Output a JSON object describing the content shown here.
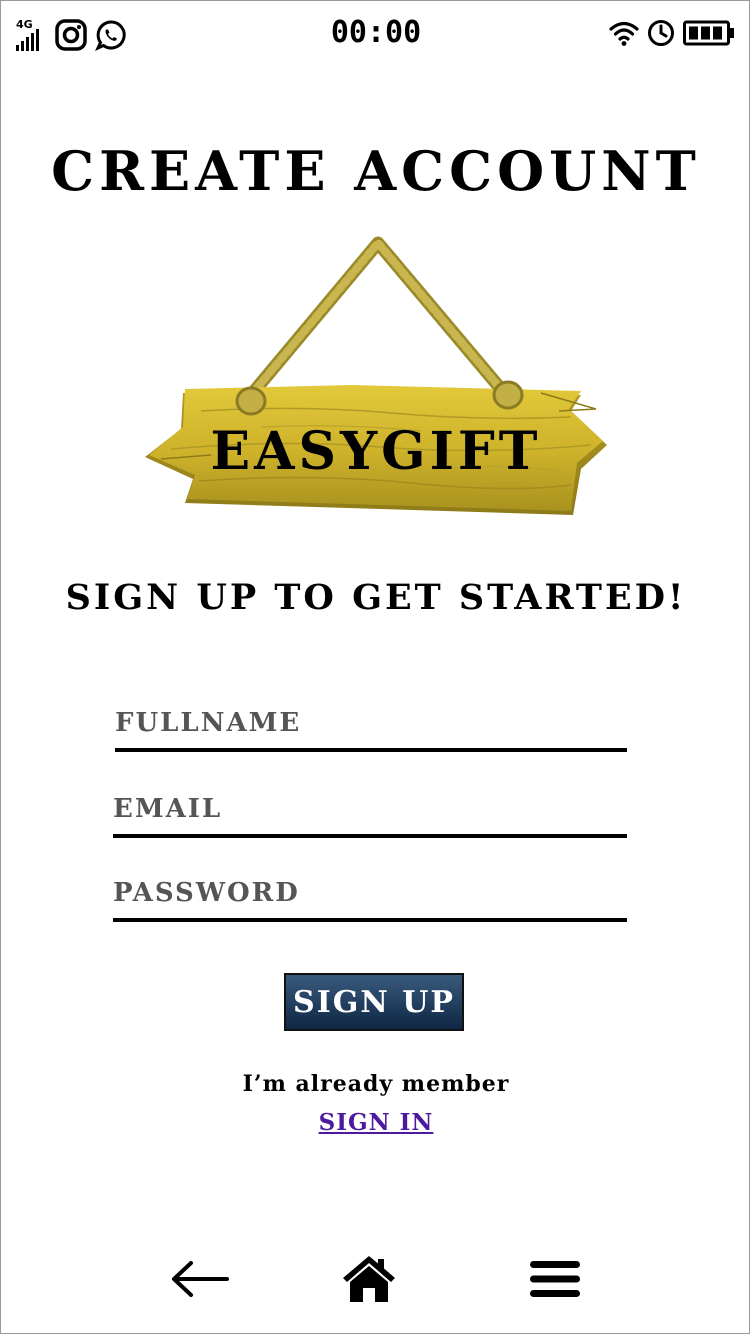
{
  "status_bar": {
    "network_label": "4G",
    "time": "00:00",
    "icons": [
      "signal-icon",
      "instagram-icon",
      "whatsapp-icon",
      "wifi-icon",
      "clock-icon",
      "battery-icon"
    ]
  },
  "page": {
    "title": "CREATE ACCOUNT",
    "logo_text": "EASYGIFT",
    "subtitle": "SIGN UP TO GET STARTED!"
  },
  "form": {
    "fullname_placeholder": "FULLNAME",
    "email_placeholder": "EMAIL",
    "password_placeholder": "PASSWORD",
    "submit_label": "SIGN UP"
  },
  "footer": {
    "member_text": "I’m already member",
    "signin_label": "SIGN IN"
  },
  "bottom_nav": {
    "items": [
      "back-arrow-icon",
      "home-icon",
      "menu-icon"
    ]
  },
  "colors": {
    "button_top": "#3a5a7d",
    "button_bottom": "#0e2744",
    "link": "#4b1a9e",
    "sign_wood": "#d8be2e",
    "rope": "#b8a43c"
  }
}
